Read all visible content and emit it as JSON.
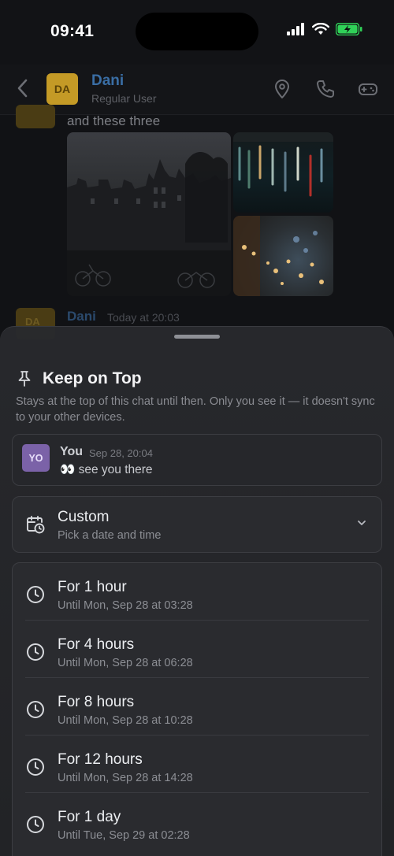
{
  "status_bar": {
    "time": "09:41"
  },
  "chat_header": {
    "avatar_initials": "DA",
    "name": "Dani",
    "subtitle": "Regular User"
  },
  "chat": {
    "message_text": "and these three",
    "second_message": {
      "avatar_initials": "DA",
      "name": "Dani",
      "time": "Today at 20:03"
    }
  },
  "sheet": {
    "title": "Keep on Top",
    "description": "Stays at the top of this chat until then. Only you see it — it doesn't sync to your other devices.",
    "preview": {
      "avatar_initials": "YO",
      "sender": "You",
      "time": "Sep 28, 20:04",
      "message": "👀 see you there"
    },
    "custom_option": {
      "title": "Custom",
      "subtitle": "Pick a date and time"
    },
    "duration_options": [
      {
        "title": "For 1 hour",
        "subtitle": "Until Mon, Sep 28 at 03:28"
      },
      {
        "title": "For 4 hours",
        "subtitle": "Until Mon, Sep 28 at 06:28"
      },
      {
        "title": "For 8 hours",
        "subtitle": "Until Mon, Sep 28 at 10:28"
      },
      {
        "title": "For 12 hours",
        "subtitle": "Until Mon, Sep 28 at 14:28"
      },
      {
        "title": "For 1 day",
        "subtitle": "Until Tue, Sep 29 at 02:28"
      }
    ]
  },
  "colors": {
    "sheet_background": "#28292d",
    "accent_user_name": "#3a6ea5",
    "avatar_da": "#c49a26",
    "avatar_yo": "#7b62a8",
    "battery_green": "#30d158"
  },
  "icons": {
    "back": "chevron-left-icon",
    "location": "map-pin-icon",
    "call": "phone-icon",
    "game": "gamepad-icon",
    "pin": "pin-icon",
    "calendar": "calendar-clock-icon",
    "clock": "clock-icon",
    "expand": "chevron-down-icon"
  }
}
